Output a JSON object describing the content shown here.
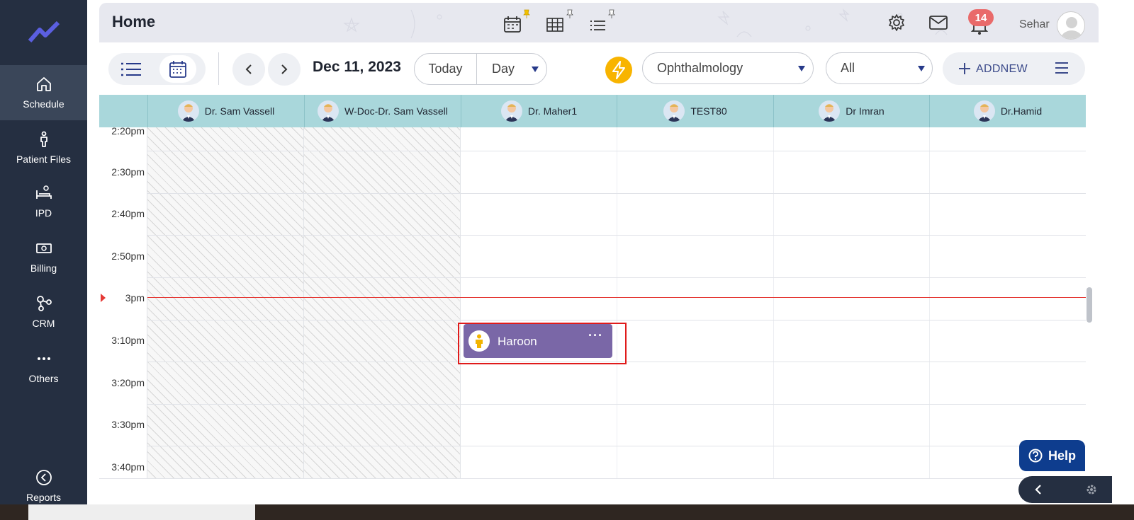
{
  "sidebar": {
    "items": [
      {
        "label": "Schedule",
        "icon": "home-icon"
      },
      {
        "label": "Patient Files",
        "icon": "person-icon"
      },
      {
        "label": "IPD",
        "icon": "bed-icon"
      },
      {
        "label": "Billing",
        "icon": "cash-icon"
      },
      {
        "label": "CRM",
        "icon": "network-icon"
      },
      {
        "label": "Others",
        "icon": "more-icon"
      },
      {
        "label": "Reports",
        "icon": "pie-chart-icon"
      }
    ]
  },
  "header": {
    "title": "Home",
    "notification_count": "14",
    "user_name": "Sehar"
  },
  "toolbar": {
    "date": "Dec 11, 2023",
    "today_label": "Today",
    "view_label": "Day",
    "specialty": "Ophthalmology",
    "filter": "All",
    "addnew_label": "ADDNEW"
  },
  "calendar": {
    "doctors": [
      "Dr. Sam Vassell",
      "W-Doc-Dr. Sam Vassell",
      "Dr. Maher1",
      "TEST80",
      "Dr Imran",
      "Dr.Hamid"
    ],
    "times": [
      "2:20pm",
      "2:30pm",
      "2:40pm",
      "2:50pm",
      "3pm",
      "3:10pm",
      "3:20pm",
      "3:30pm",
      "3:40pm"
    ],
    "appointment": {
      "name": "Haroon",
      "more": "···"
    }
  },
  "help_label": "Help",
  "colors": {
    "sidebar_bg": "#252f41",
    "header_cyan": "#a9d7db",
    "appointment": "#7a67a7",
    "now_line": "#e53935",
    "accent_blue": "#273a8a"
  }
}
